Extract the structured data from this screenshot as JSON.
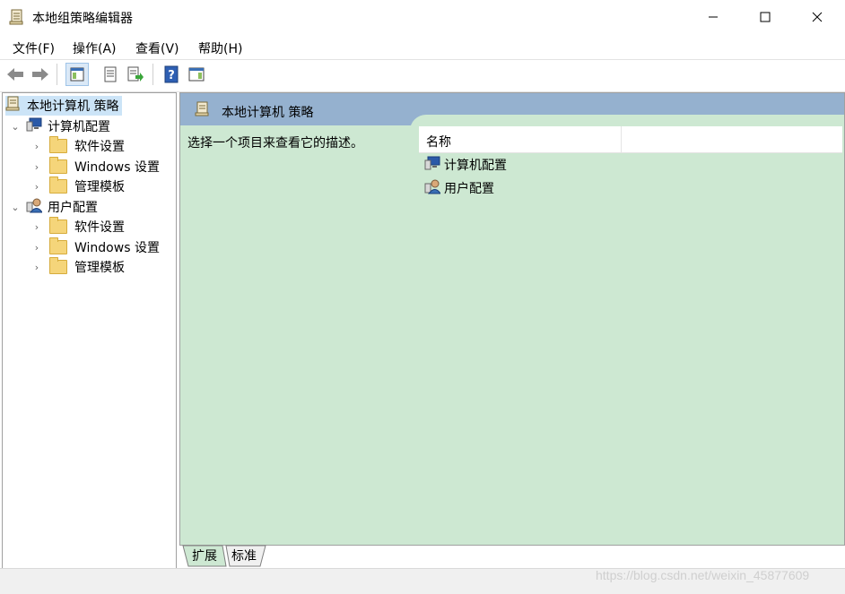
{
  "window": {
    "title": "本地组策略编辑器"
  },
  "menu": [
    "文件(F)",
    "操作(A)",
    "查看(V)",
    "帮助(H)"
  ],
  "toolbar": {
    "icons": [
      "back-icon",
      "forward-icon",
      "show-hide-tree-icon",
      "properties-icon",
      "export-list-icon",
      "help-icon",
      "show-action-pane-icon"
    ]
  },
  "tree": {
    "root": "本地计算机 策略",
    "computer": {
      "label": "计算机配置",
      "children": [
        "软件设置",
        "Windows 设置",
        "管理模板"
      ]
    },
    "user": {
      "label": "用户配置",
      "children": [
        "软件设置",
        "Windows 设置",
        "管理模板"
      ]
    }
  },
  "right": {
    "title": "本地计算机 策略",
    "description": "选择一个项目来查看它的描述。",
    "column_name": "名称",
    "items": [
      "计算机配置",
      "用户配置"
    ]
  },
  "tabs": [
    "扩展",
    "标准"
  ],
  "watermark": "https://blog.csdn.net/weixin_45877609",
  "colors": {
    "header_blue": "#95b1cf",
    "pane_green": "#cde8d2",
    "selection": "#cce4f7"
  }
}
